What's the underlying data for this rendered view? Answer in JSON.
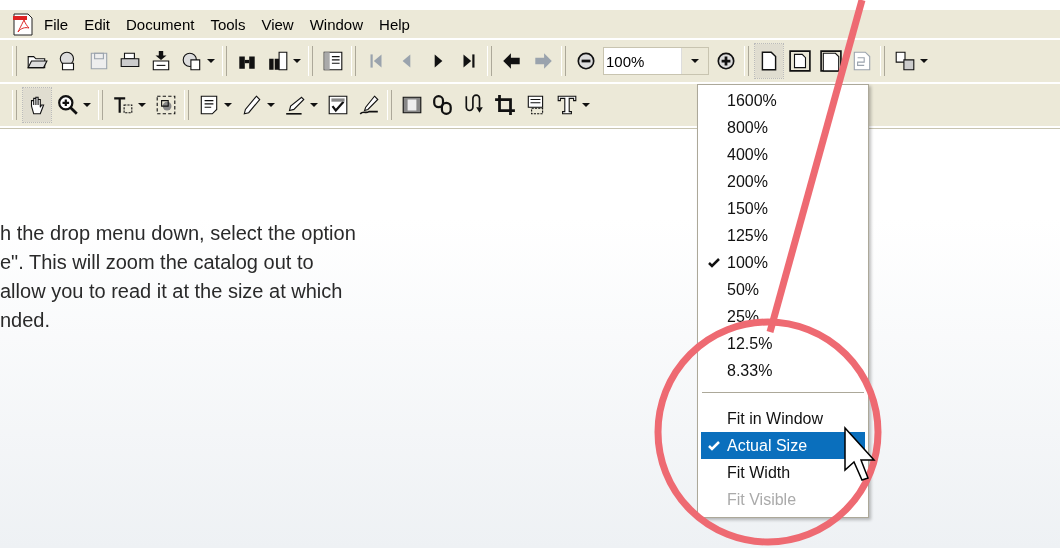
{
  "menu_bar": {
    "items": [
      "File",
      "Edit",
      "Document",
      "Tools",
      "View",
      "Window",
      "Help"
    ]
  },
  "toolbars": [
    {
      "groups": [
        [
          {
            "kind": "button",
            "dropdown": false,
            "disabled": false,
            "selected": false
          },
          {
            "kind": "button",
            "dropdown": false,
            "disabled": false,
            "selected": false
          },
          {
            "kind": "button",
            "dropdown": false,
            "disabled": true,
            "selected": false
          },
          {
            "kind": "button",
            "dropdown": false,
            "disabled": false,
            "selected": false
          },
          {
            "kind": "button",
            "dropdown": false,
            "disabled": false,
            "selected": false
          },
          {
            "kind": "button",
            "dropdown": true,
            "disabled": false,
            "selected": false
          }
        ],
        [
          {
            "kind": "button",
            "dropdown": false,
            "disabled": false,
            "selected": false
          },
          {
            "kind": "button",
            "dropdown": true,
            "disabled": false,
            "selected": false
          }
        ],
        [
          {
            "kind": "button",
            "dropdown": false,
            "disabled": false,
            "selected": false
          }
        ],
        [
          {
            "kind": "button",
            "dropdown": false,
            "disabled": true,
            "selected": false
          },
          {
            "kind": "button",
            "dropdown": false,
            "disabled": true,
            "selected": false
          },
          {
            "kind": "button",
            "dropdown": false,
            "disabled": false,
            "selected": false
          },
          {
            "kind": "button",
            "dropdown": false,
            "disabled": false,
            "selected": false
          }
        ],
        [
          {
            "kind": "button",
            "dropdown": false,
            "disabled": false,
            "selected": false
          },
          {
            "kind": "button",
            "dropdown": false,
            "disabled": true,
            "selected": false
          }
        ],
        [
          {
            "kind": "button",
            "dropdown": false,
            "disabled": false,
            "selected": false
          },
          {
            "kind": "combo",
            "value": "100%"
          },
          {
            "kind": "button",
            "dropdown": false,
            "disabled": false,
            "selected": false
          }
        ],
        [
          {
            "kind": "button",
            "dropdown": false,
            "disabled": false,
            "selected": true
          },
          {
            "kind": "button",
            "dropdown": false,
            "disabled": false,
            "selected": false
          },
          {
            "kind": "button",
            "dropdown": false,
            "disabled": false,
            "selected": false
          },
          {
            "kind": "button",
            "dropdown": false,
            "disabled": true,
            "selected": false
          }
        ],
        [
          {
            "kind": "button",
            "dropdown": true,
            "disabled": false,
            "selected": false
          }
        ]
      ]
    },
    {
      "groups": [
        [
          {
            "kind": "button",
            "dropdown": false,
            "disabled": false,
            "selected": true
          },
          {
            "kind": "button",
            "dropdown": true,
            "disabled": false,
            "selected": false
          }
        ],
        [
          {
            "kind": "button",
            "dropdown": true,
            "disabled": false,
            "selected": false
          },
          {
            "kind": "button",
            "dropdown": false,
            "disabled": false,
            "selected": false
          }
        ],
        [
          {
            "kind": "button",
            "dropdown": true,
            "disabled": false,
            "selected": false
          },
          {
            "kind": "button",
            "dropdown": true,
            "disabled": false,
            "selected": false
          },
          {
            "kind": "button",
            "dropdown": true,
            "disabled": false,
            "selected": false
          },
          {
            "kind": "button",
            "dropdown": false,
            "disabled": false,
            "selected": false
          },
          {
            "kind": "button",
            "dropdown": false,
            "disabled": false,
            "selected": false
          }
        ],
        [
          {
            "kind": "button",
            "dropdown": false,
            "disabled": false,
            "selected": false
          },
          {
            "kind": "button",
            "dropdown": false,
            "disabled": false,
            "selected": false
          },
          {
            "kind": "button",
            "dropdown": false,
            "disabled": false,
            "selected": false
          },
          {
            "kind": "button",
            "dropdown": false,
            "disabled": false,
            "selected": false
          },
          {
            "kind": "button",
            "dropdown": false,
            "disabled": false,
            "selected": false
          },
          {
            "kind": "button",
            "dropdown": true,
            "disabled": false,
            "selected": false
          }
        ]
      ]
    }
  ],
  "instructions": {
    "lines": [
      "h the drop menu down, select the option",
      "e\". This will zoom the catalog out to",
      "allow you to read it at the size at which",
      "nded."
    ]
  },
  "zoom_menu": {
    "items": [
      {
        "kind": "option",
        "label": "1600%",
        "checked": false,
        "selected": false,
        "disabled": false
      },
      {
        "kind": "option",
        "label": "800%",
        "checked": false,
        "selected": false,
        "disabled": false
      },
      {
        "kind": "option",
        "label": "400%",
        "checked": false,
        "selected": false,
        "disabled": false
      },
      {
        "kind": "option",
        "label": "200%",
        "checked": false,
        "selected": false,
        "disabled": false
      },
      {
        "kind": "option",
        "label": "150%",
        "checked": false,
        "selected": false,
        "disabled": false
      },
      {
        "kind": "option",
        "label": "125%",
        "checked": false,
        "selected": false,
        "disabled": false
      },
      {
        "kind": "option",
        "label": "100%",
        "checked": true,
        "selected": false,
        "disabled": false
      },
      {
        "kind": "option",
        "label": "50%",
        "checked": false,
        "selected": false,
        "disabled": false
      },
      {
        "kind": "option",
        "label": "25%",
        "checked": false,
        "selected": false,
        "disabled": false
      },
      {
        "kind": "option",
        "label": "12.5%",
        "checked": false,
        "selected": false,
        "disabled": false
      },
      {
        "kind": "option",
        "label": "8.33%",
        "checked": false,
        "selected": false,
        "disabled": false
      },
      {
        "kind": "separator"
      },
      {
        "kind": "option",
        "label": "Fit in Window",
        "checked": false,
        "selected": false,
        "disabled": false
      },
      {
        "kind": "option",
        "label": "Actual Size",
        "checked": true,
        "selected": true,
        "disabled": false
      },
      {
        "kind": "option",
        "label": "Fit Width",
        "checked": false,
        "selected": false,
        "disabled": false
      },
      {
        "kind": "option",
        "label": "Fit Visible",
        "checked": false,
        "selected": false,
        "disabled": true
      }
    ]
  }
}
